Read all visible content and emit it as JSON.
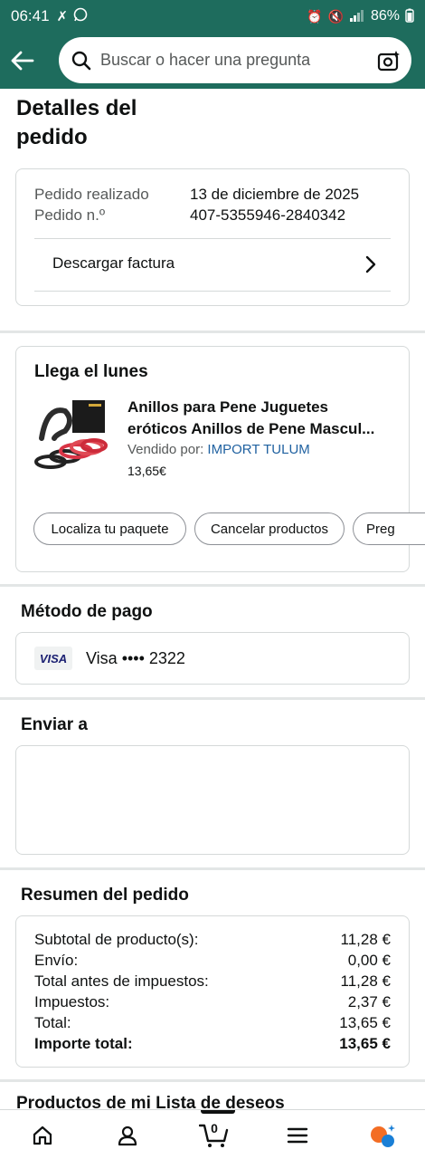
{
  "status_bar": {
    "time": "06:41",
    "battery": "86%"
  },
  "search": {
    "placeholder": "Buscar o hacer una pregunta"
  },
  "page": {
    "title": "Detalles del pedido"
  },
  "order_info": {
    "placed_label": "Pedido realizado",
    "placed_value": "13 de diciembre de 2025",
    "number_label": "Pedido n.º",
    "number_value": "407-5355946-2840342",
    "invoice_label": "Descargar factura"
  },
  "shipment": {
    "heading": "Llega el lunes",
    "product_title_line1": "Anillos para Pene Juguetes",
    "product_title_line2": "eróticos Anillos de Pene Mascul...",
    "sold_by_label": "Vendido por:",
    "seller": "IMPORT TULUM",
    "price": "13,65€",
    "actions": [
      "Localiza tu paquete",
      "Cancelar productos",
      "Preg"
    ]
  },
  "payment": {
    "heading": "Método de pago",
    "card_brand": "VISA",
    "card_text": "Visa •••• 2322"
  },
  "shipping": {
    "heading": "Enviar a"
  },
  "summary": {
    "heading": "Resumen del pedido",
    "rows": [
      {
        "label": "Subtotal de producto(s):",
        "value": "11,28 €"
      },
      {
        "label": "Envío:",
        "value": "0,00 €"
      },
      {
        "label": "Total antes de impuestos:",
        "value": "11,28 €"
      },
      {
        "label": "Impuestos:",
        "value": "2,37 €"
      },
      {
        "label": "Total:",
        "value": "13,65 €"
      },
      {
        "label": "Importe total:",
        "value": "13,65 €"
      }
    ]
  },
  "wishlist": {
    "heading": "Productos de mi Lista de deseos"
  },
  "bottom_nav": {
    "cart_count": "0"
  },
  "colors": {
    "header": "#1e6c5d",
    "link": "#2162a1",
    "rufus_orange": "#f36d24",
    "rufus_blue": "#1a7fd6"
  }
}
